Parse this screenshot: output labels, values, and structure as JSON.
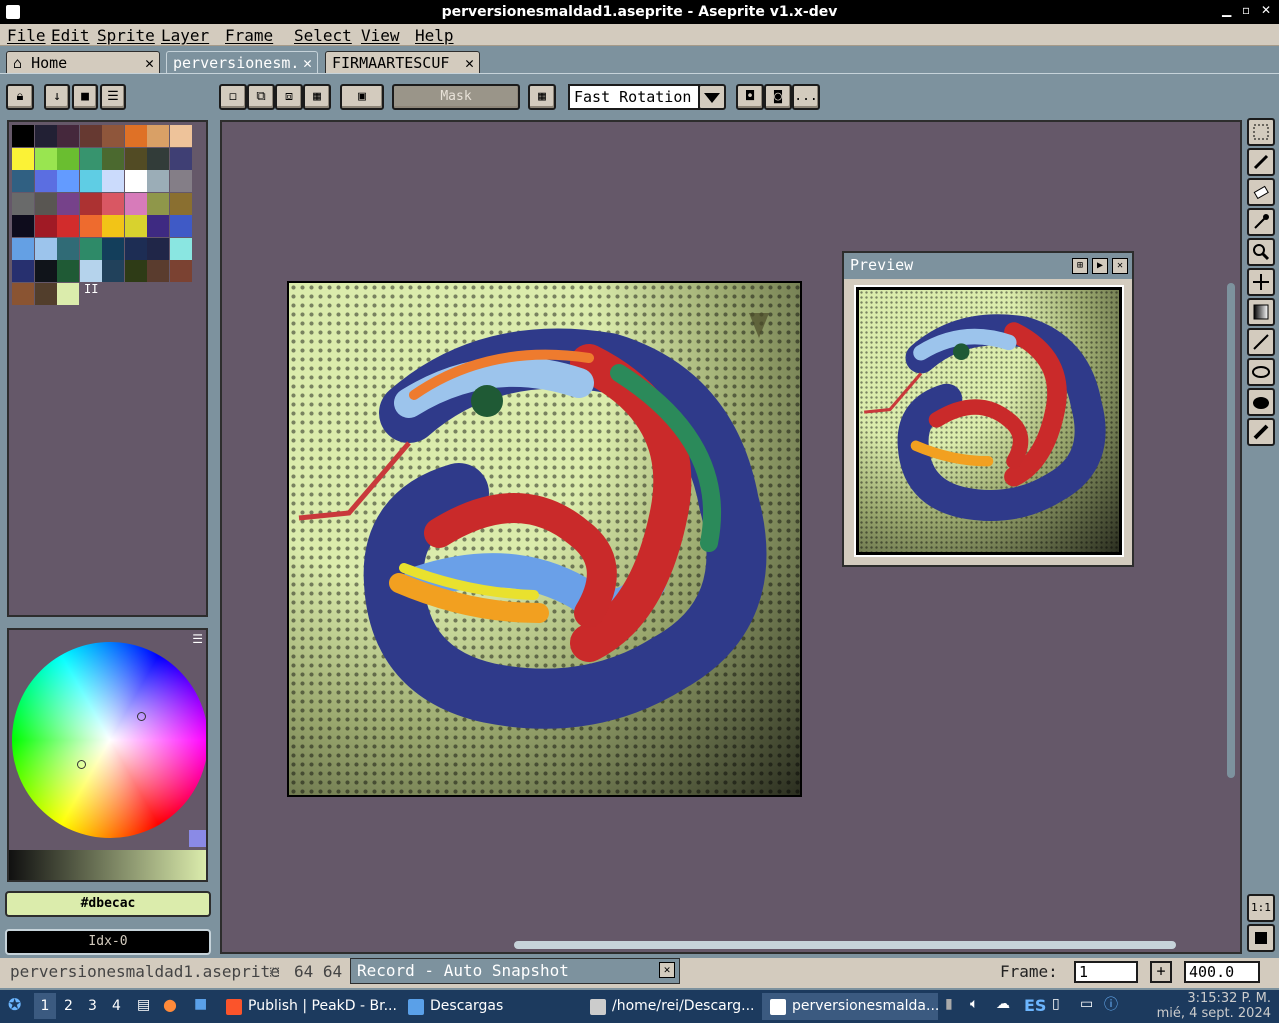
{
  "window": {
    "title": "perversionesmaldad1.aseprite - Aseprite v1.x-dev"
  },
  "menu": [
    "File",
    "Edit",
    "Sprite",
    "Layer",
    "Frame",
    "Select",
    "View",
    "Help"
  ],
  "tabs": [
    {
      "label": "Home",
      "close": "✕"
    },
    {
      "label": "perversionesm.",
      "close": "✕"
    },
    {
      "label": "FIRMAARTESCUF",
      "close": "✕"
    }
  ],
  "toolbar": {
    "mask_label": "Mask",
    "rotation": "Fast Rotation",
    "more": "..."
  },
  "palette": {
    "colors": [
      "#000000",
      "#222034",
      "#45283c",
      "#663931",
      "#8f563b",
      "#df7126",
      "#d9a066",
      "#eec39a",
      "#fbf236",
      "#99e550",
      "#6abe30",
      "#37946e",
      "#4b692f",
      "#524b24",
      "#323c39",
      "#3f3f74",
      "#306082",
      "#5b6ee1",
      "#639bff",
      "#5fcde4",
      "#cbdbfc",
      "#ffffff",
      "#9badb7",
      "#847e87",
      "#696a6a",
      "#595652",
      "#76428a",
      "#ac3232",
      "#d95763",
      "#d77bba",
      "#8f974a",
      "#8a6f30",
      "#0e0c1c",
      "#a01a25",
      "#d22c2c",
      "#ee6b2e",
      "#f2c417",
      "#d8d22e",
      "#3e2a82",
      "#3f5ac6",
      "#64a0e4",
      "#9cc4ec",
      "#306b76",
      "#2e8a68",
      "#133e5b",
      "#1d2d54",
      "#202648",
      "#8ae6e1",
      "#27306f",
      "#10141a",
      "#1f5a35",
      "#b5d3ec",
      "#21415b",
      "#2e3b16",
      "#5a3c2e",
      "#7b4232",
      "#8a5432",
      "#523e2c",
      "#dbecac"
    ],
    "more": "II"
  },
  "color": {
    "hex": "#dbecac",
    "index": "Idx-0"
  },
  "preview": {
    "title": "Preview"
  },
  "status": {
    "filename": "perversionesmaldad1.aseprite",
    "size": "64 64",
    "record": "Record - Auto Snapshot",
    "frame_label": "Frame:",
    "frame_value": "1",
    "add": "+",
    "zoom": "400.0"
  },
  "zoom_buttons": {
    "one_to_one": "1:1"
  },
  "taskbar": {
    "workspaces": [
      "1",
      "2",
      "3",
      "4"
    ],
    "windows": [
      "Publish | PeakD - Br...",
      "Descargas",
      "/home/rei/Descarg...",
      "perversionesmalda..."
    ],
    "lang": "ES",
    "time": "3:15:32 P. M.",
    "date": "mié, 4 sept. 2024"
  }
}
